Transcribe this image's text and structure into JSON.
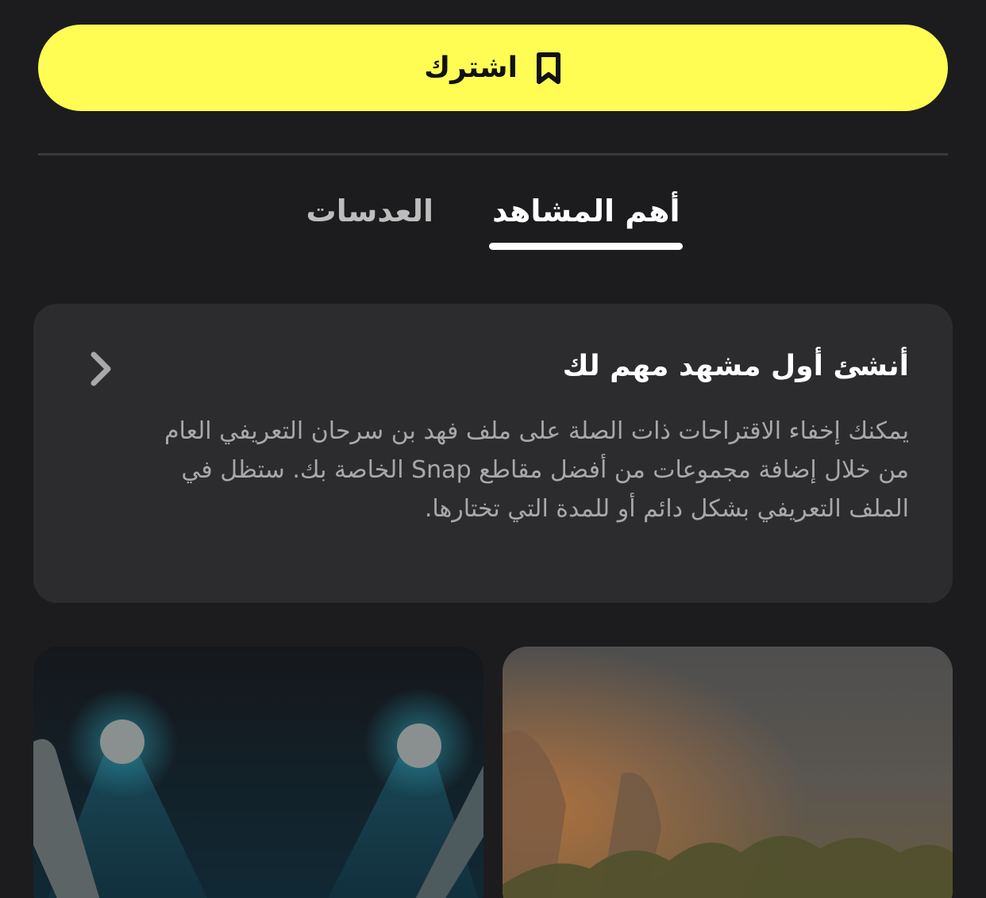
{
  "subscribe": {
    "label": "اشترك",
    "icon": "bookmark-icon",
    "color": "#fffc54"
  },
  "tabs": [
    {
      "label": "أهم المشاهد",
      "active": true
    },
    {
      "label": "العدسات",
      "active": false
    }
  ],
  "info_card": {
    "title": "أنشئ أول مشهد مهم لك",
    "body": "يمكنك إخفاء الاقتراحات ذات الصلة على ملف فهد بن سرحان التعريفي العام من خلال إضافة مجموعات من أفضل مقاطع Snap الخاصة بك. ستظل في الملف التعريفي بشكل دائم أو للمدة التي تختارها.",
    "chevron_icon": "chevron-right-icon"
  },
  "tiles": [
    {
      "name": "concert-lights-thumbnail"
    },
    {
      "name": "sunset-field-thumbnail"
    }
  ]
}
